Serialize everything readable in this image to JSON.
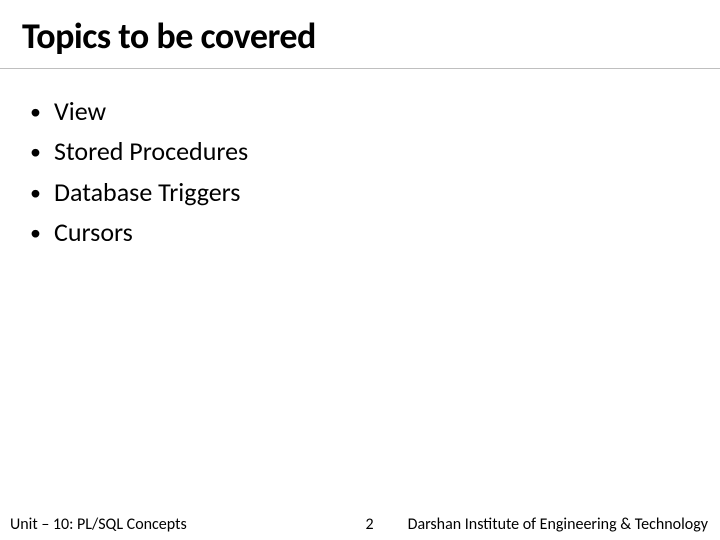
{
  "title": "Topics to be covered",
  "bullets": {
    "items": [
      {
        "label": "View"
      },
      {
        "label": "Stored Procedures"
      },
      {
        "label": "Database Triggers"
      },
      {
        "label": "Cursors"
      }
    ]
  },
  "footer": {
    "unit": "Unit – 10: PL/SQL Concepts",
    "page": "2",
    "institute": "Darshan Institute of Engineering & Technology"
  }
}
